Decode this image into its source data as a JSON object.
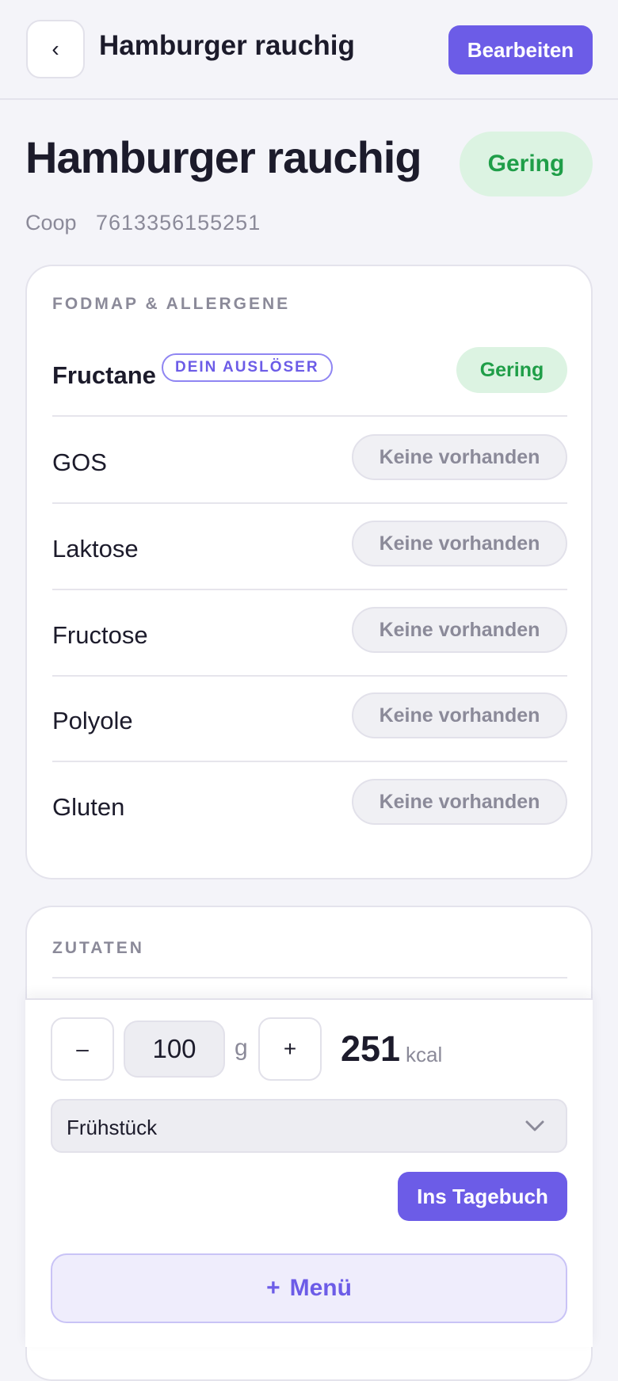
{
  "header": {
    "back_icon": "chevron-left-icon",
    "back_glyph": "‹",
    "title": "Hamburger rauchig",
    "edit_label": "Bearbeiten"
  },
  "product": {
    "name": "Hamburger rauchig",
    "overall_rating": "Gering",
    "brand": "Coop",
    "barcode": "7613356155251"
  },
  "fodmap": {
    "section_title": "FODMAP & ALLERGENE",
    "rows": [
      {
        "label": "Fructane",
        "tag": "DEIN AUSLÖSER",
        "level": "Gering"
      },
      {
        "label": "GOS",
        "level": "Keine vorhanden"
      },
      {
        "label": "Laktose",
        "level": "Keine vorhanden"
      },
      {
        "label": "Fructose",
        "level": "Keine vorhanden"
      },
      {
        "label": "Polyole",
        "level": "Keine vorhanden"
      },
      {
        "label": "Gluten",
        "level": "Keine vorhanden"
      }
    ]
  },
  "ingredients": {
    "section_title": "ZUTATEN"
  },
  "portion": {
    "minus_label": "–",
    "plus_label": "+",
    "amount": "100",
    "unit": "g",
    "kcal_value": "251",
    "kcal_unit": "kcal",
    "meal": "Frühstück",
    "meal_icon": "chevron-down-icon",
    "add_to_diary_label": "Ins Tagebuch",
    "menu_plus": "+",
    "menu_label": "Menü"
  },
  "colors": {
    "accent": "#6c5ce7",
    "good_text": "#1f9e48",
    "good_bg": "#dcf3e2",
    "muted": "#8b8a99",
    "background": "#f4f4f9"
  }
}
